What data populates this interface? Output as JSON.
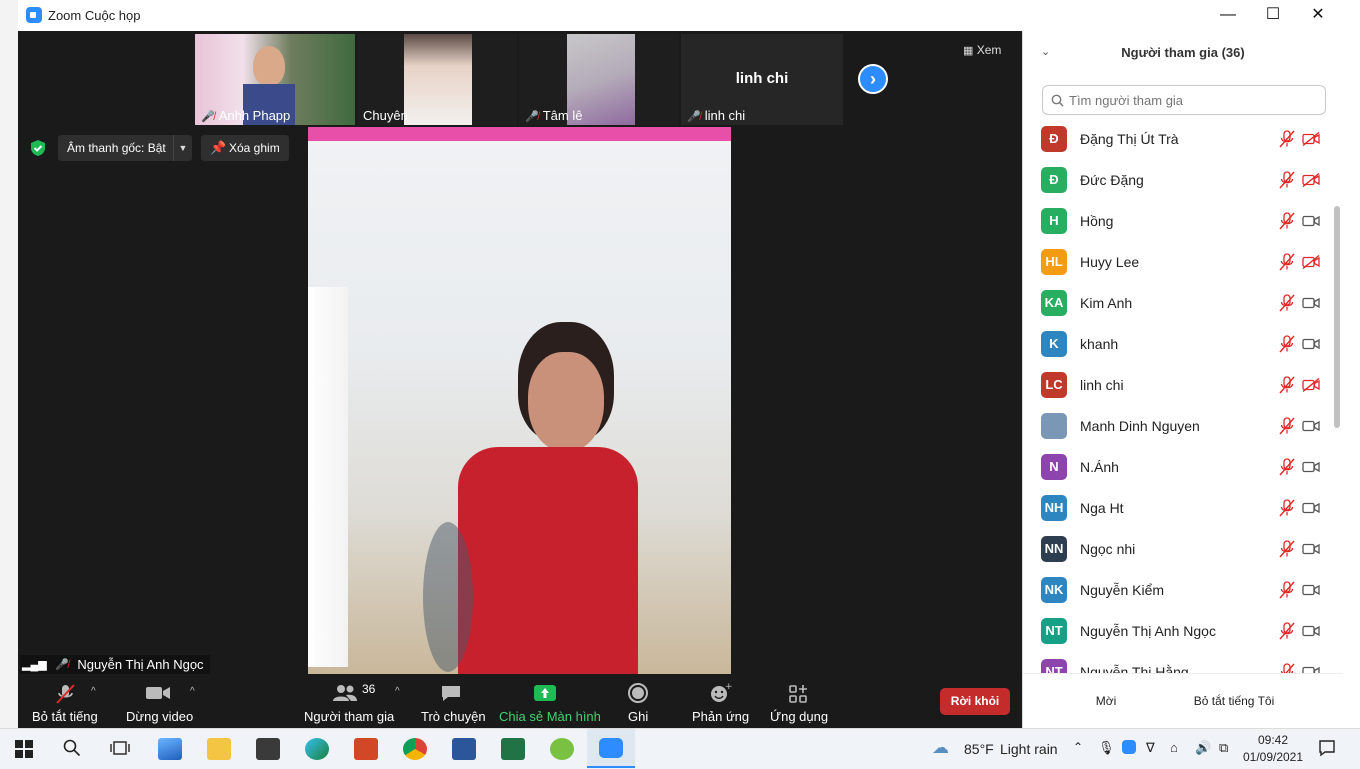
{
  "window": {
    "title": "Zoom Cuộc họp",
    "minimize_glyph": "—",
    "maximize_glyph": "☐",
    "close_glyph": "✕"
  },
  "thumbnails": [
    {
      "name": "Anhh Phapp",
      "muted": true
    },
    {
      "name": "Chuyên",
      "muted": false
    },
    {
      "name": "Tâm lê",
      "muted": true
    },
    {
      "name": "linh chi",
      "muted": true,
      "center_name": "linh chi"
    }
  ],
  "view_button": {
    "label": "Xem"
  },
  "audio": {
    "original_sound_label": "Âm thanh gốc: Bật",
    "unpin_label": "Xóa ghim"
  },
  "speaker": {
    "name": "Nguyễn Thị Anh Ngọc"
  },
  "controls": {
    "mute_label": "Bỏ tắt tiếng",
    "video_label": "Dừng video",
    "participants_label": "Người tham gia",
    "participants_count": "36",
    "chat_label": "Trò chuyện",
    "share_label": "Chia sẻ Màn hình",
    "record_label": "Ghi",
    "reactions_label": "Phản ứng",
    "apps_label": "Ứng dụng",
    "leave_label": "Rời khỏi"
  },
  "panel": {
    "title": "Người tham gia (36)",
    "search_placeholder": "Tìm người tham gia",
    "invite_label": "Mời",
    "unmute_me_label": "Bỏ tắt tiếng Tôi",
    "participants": [
      {
        "initials": "Đ",
        "name": "Đặng Thị Út Trà",
        "color": "#c0392b",
        "cam_off": true
      },
      {
        "initials": "Đ",
        "name": "Đức Đặng",
        "color": "#27ae60",
        "cam_off": true
      },
      {
        "initials": "H",
        "name": "Hồng",
        "color": "#27ae60",
        "cam_off": false
      },
      {
        "initials": "HL",
        "name": "Huyy Lee",
        "color": "#f39c12",
        "cam_off": true
      },
      {
        "initials": "KA",
        "name": "Kim Anh",
        "color": "#27ae60",
        "cam_off": false
      },
      {
        "initials": "K",
        "name": "khanh",
        "color": "#2e86c1",
        "cam_off": false
      },
      {
        "initials": "LC",
        "name": "linh chi",
        "color": "#c0392b",
        "cam_off": true
      },
      {
        "initials": "",
        "name": "Manh Dinh Nguyen",
        "color": "#7a97b5",
        "cam_off": false
      },
      {
        "initials": "N",
        "name": "N.Ánh",
        "color": "#8e44ad",
        "cam_off": false
      },
      {
        "initials": "NH",
        "name": "Nga Ht",
        "color": "#2e86c1",
        "cam_off": false
      },
      {
        "initials": "NN",
        "name": "Ngọc nhi",
        "color": "#2c3e50",
        "cam_off": false
      },
      {
        "initials": "NK",
        "name": "Nguyễn Kiểm",
        "color": "#2e86c1",
        "cam_off": false
      },
      {
        "initials": "NT",
        "name": "Nguyễn Thị Anh Ngọc",
        "color": "#16a085",
        "cam_off": false
      },
      {
        "initials": "NT",
        "name": "Nguyễn Thị Hằng",
        "color": "#8e44ad",
        "cam_off": false
      }
    ]
  },
  "taskbar": {
    "weather_temp": "85°F",
    "weather_desc": "Light rain",
    "time": "09:42",
    "date": "01/09/2021"
  },
  "colors": {
    "zoom_blue": "#2d8cff",
    "leave_red": "#c42b2b",
    "share_green": "#1eba54",
    "muted_red": "#e02828"
  }
}
